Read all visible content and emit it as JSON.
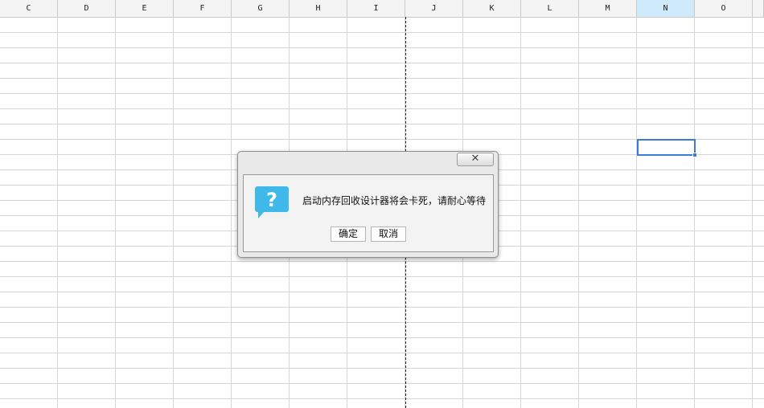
{
  "sheet": {
    "columns": [
      "C",
      "D",
      "E",
      "F",
      "G",
      "H",
      "I",
      "J",
      "K",
      "L",
      "M",
      "N",
      "O"
    ],
    "selected_column": "N",
    "colors": {
      "selection": "#3a7bd5",
      "header_selected": "#cfeafb",
      "grid": "#d4d4d4"
    }
  },
  "dialog": {
    "close_symbol": "✕",
    "message": "启动内存回收设计器将会卡死，请耐心等待",
    "icon": "question-icon",
    "icon_color": "#3fb8ea",
    "ok_label": "确定",
    "cancel_label": "取消"
  }
}
